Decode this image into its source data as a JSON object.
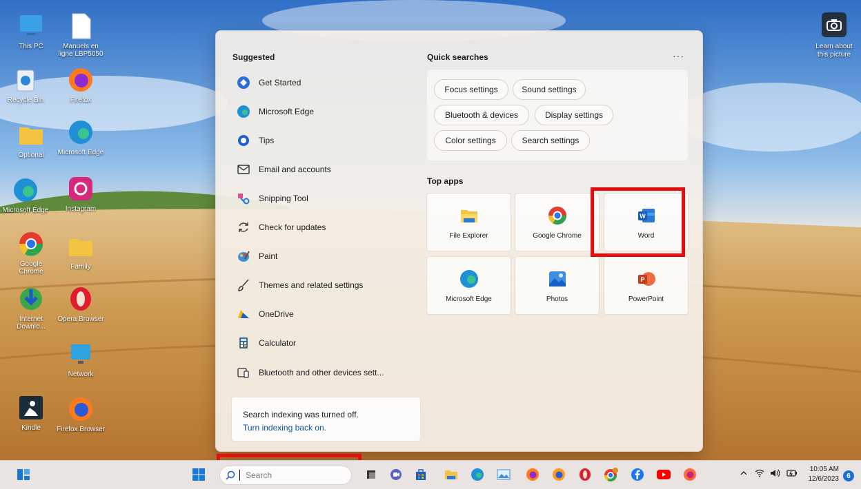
{
  "desktop": {
    "icons": [
      {
        "label": "This PC"
      },
      {
        "label": "Manuels en ligne LBP5050"
      },
      {
        "label": "Recycle Bin"
      },
      {
        "label": "Firefox"
      },
      {
        "label": "Optional"
      },
      {
        "label": "Microsoft Edge"
      },
      {
        "label": "Microsoft Edge"
      },
      {
        "label": "Instagram"
      },
      {
        "label": "Google Chrome"
      },
      {
        "label": "Family"
      },
      {
        "label": "Internet Downlo..."
      },
      {
        "label": "Opera Browser"
      },
      {
        "label": "Network"
      },
      {
        "label": "Kindle"
      },
      {
        "label": "Firefox Browser"
      }
    ],
    "learn_about": "Learn about this picture"
  },
  "panel": {
    "suggested_title": "Suggested",
    "suggested": [
      {
        "label": "Get Started",
        "icon": "get-started-icon"
      },
      {
        "label": "Microsoft Edge",
        "icon": "edge-icon"
      },
      {
        "label": "Tips",
        "icon": "tips-icon"
      },
      {
        "label": "Email and accounts",
        "icon": "mail-icon"
      },
      {
        "label": "Snipping Tool",
        "icon": "snipping-tool-icon"
      },
      {
        "label": "Check for updates",
        "icon": "refresh-icon"
      },
      {
        "label": "Paint",
        "icon": "paint-icon"
      },
      {
        "label": "Themes and related settings",
        "icon": "brush-icon"
      },
      {
        "label": "OneDrive",
        "icon": "onedrive-icon"
      },
      {
        "label": "Calculator",
        "icon": "calculator-icon"
      },
      {
        "label": "Bluetooth and other devices sett...",
        "icon": "devices-icon"
      }
    ],
    "quick_searches_title": "Quick searches",
    "more": "···",
    "quick_searches": [
      "Focus settings",
      "Sound settings",
      "Bluetooth & devices",
      "Display settings",
      "Color settings",
      "Search settings"
    ],
    "top_apps_title": "Top apps",
    "top_apps": [
      {
        "label": "File Explorer"
      },
      {
        "label": "Google Chrome"
      },
      {
        "label": "Word"
      },
      {
        "label": "Microsoft Edge"
      },
      {
        "label": "Photos"
      },
      {
        "label": "PowerPoint"
      }
    ],
    "notice": {
      "text": "Search indexing was turned off.",
      "link": "Turn indexing back on."
    }
  },
  "taskbar": {
    "search_placeholder": "Search",
    "time": "10:05 AM",
    "date": "12/6/2023",
    "notifications": "6"
  }
}
